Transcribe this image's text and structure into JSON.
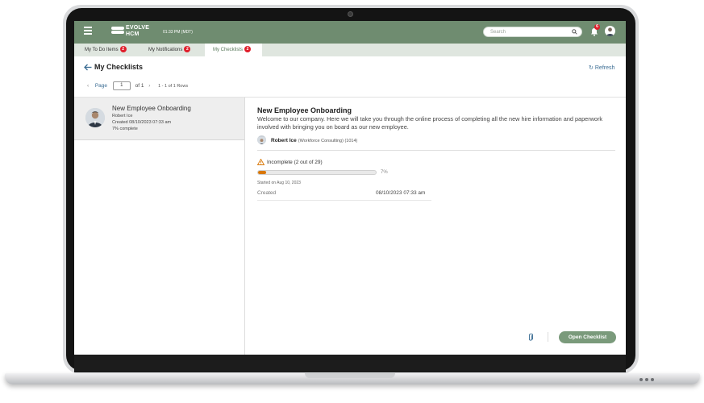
{
  "header": {
    "logo_line1": "EVOLVE",
    "logo_line2": "HCM",
    "clock": "01:33 PM (MDT)",
    "search_placeholder": "Search",
    "notification_count": "6"
  },
  "tabs": [
    {
      "label": "My To Do Items",
      "badge": "2"
    },
    {
      "label": "My Notifications",
      "badge": "2"
    },
    {
      "label": "My Checklists",
      "badge": "2"
    }
  ],
  "page": {
    "title": "My Checklists",
    "refresh_label": "Refresh",
    "pager": {
      "page_label": "Page",
      "page_value": "1",
      "of_label": "of 1",
      "rows_label": "1 - 1 of 1 Rows"
    }
  },
  "list": [
    {
      "title": "New Employee Onboarding",
      "person": "Robert Ice",
      "created": "Created 08/10/2023 07:33 am",
      "complete": "7% complete"
    }
  ],
  "detail": {
    "title": "New Employee Onboarding",
    "description": "Welcome to our company. Here we will take you through the online process of completing all the new hire information and paperwork involved with bringing you on board as our new employee.",
    "owner_name": "Robert Ice",
    "owner_sub": "(Workforce Consulting) (1014)",
    "status": "Incomplete (2 out of 29)",
    "progress_percent": 7,
    "progress_label": "7%",
    "started": "Started on Aug 10, 2023",
    "created_label": "Created",
    "created_value": "08/10/2023 07:33 am",
    "open_button": "Open Checklist"
  },
  "colors": {
    "brand_green": "#6f8c70",
    "badge_red": "#e01e2b",
    "progress_orange": "#d97706",
    "link_blue": "#3a6c93"
  }
}
